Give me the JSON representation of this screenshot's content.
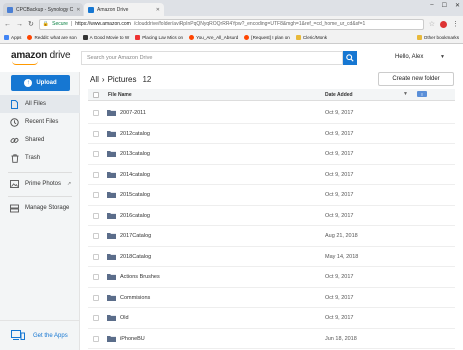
{
  "browser": {
    "tabs": [
      {
        "title": "CPCBackup - Synology C"
      },
      {
        "title": "Amazon Drive"
      }
    ],
    "secure_label": "Secure",
    "url_host": "https://www.amazon.com",
    "url_path": "/clouddrive/folder/aviRpInPqQNyqROQrRR4Ypw?_encoding=UTF8&mgh=1&ref_=cd_home_ur_cd&sf=1",
    "bookmarks": [
      {
        "label": "Apps"
      },
      {
        "label": "Reddit: what are son"
      },
      {
        "label": "A Good Movie to W"
      },
      {
        "label": "Placing Lav Mics on"
      },
      {
        "label": "You_Are_All_Absurd"
      },
      {
        "label": "[Request] I plan on"
      },
      {
        "label": "Cleric/Monk"
      }
    ],
    "other_bookmarks": "Other bookmarks"
  },
  "header": {
    "logo_amazon": "amazon",
    "logo_drive": "drive",
    "search_placeholder": "Search your Amazon Drive",
    "greeting": "Hello, Alex"
  },
  "sidebar": {
    "upload_label": "Upload",
    "items": [
      {
        "label": "All Files"
      },
      {
        "label": "Recent Files"
      },
      {
        "label": "Shared"
      },
      {
        "label": "Trash"
      },
      {
        "label": "Prime Photos"
      },
      {
        "label": "Manage Storage"
      }
    ],
    "get_apps": "Get the Apps"
  },
  "main": {
    "breadcrumb_root": "All",
    "breadcrumb_separator": "›",
    "breadcrumb_current": "Pictures",
    "item_count": "12",
    "new_folder_label": "Create new folder",
    "columns": {
      "name": "File Name",
      "date": "Date Added"
    },
    "files": [
      {
        "name": "2007-2011",
        "date": "Oct 9, 2017"
      },
      {
        "name": "2012catalog",
        "date": "Oct 9, 2017"
      },
      {
        "name": "2013catalog",
        "date": "Oct 9, 2017"
      },
      {
        "name": "2014catalog",
        "date": "Oct 9, 2017"
      },
      {
        "name": "2015catalog",
        "date": "Oct 9, 2017"
      },
      {
        "name": "2016catalog",
        "date": "Oct 9, 2017"
      },
      {
        "name": "2017Catalog",
        "date": "Aug 21, 2018"
      },
      {
        "name": "2018Catalog",
        "date": "May 14, 2018"
      },
      {
        "name": "Actions Brushes",
        "date": "Oct 9, 2017"
      },
      {
        "name": "Commisions",
        "date": "Oct 9, 2017"
      },
      {
        "name": "Old",
        "date": "Oct 9, 2017"
      },
      {
        "name": "iPhoneBU",
        "date": "Jun 18, 2018"
      }
    ]
  },
  "colors": {
    "accent": "#1677d2",
    "folder": "#5b6d8a",
    "logo_swoosh": "#ff9900"
  }
}
